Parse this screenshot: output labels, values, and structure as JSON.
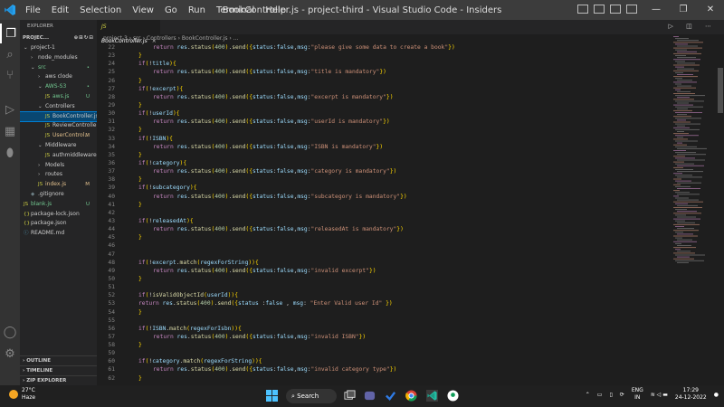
{
  "titlebar": {
    "menu": [
      "File",
      "Edit",
      "Selection",
      "View",
      "Go",
      "Run",
      "Terminal",
      "Help"
    ],
    "title": "BookController.js - project-third - Visual Studio Code - Insiders"
  },
  "sidebar": {
    "header": "EXPLORER",
    "project": "PROJEC...",
    "items": [
      {
        "label": "project-1",
        "indent": 0,
        "arrow": "⌄",
        "status": "",
        "type": "folder"
      },
      {
        "label": "node_modules",
        "indent": 1,
        "arrow": "›",
        "status": "",
        "type": "folder"
      },
      {
        "label": "src",
        "indent": 1,
        "arrow": "⌄",
        "status": "•",
        "type": "folder"
      },
      {
        "label": "aws clode",
        "indent": 2,
        "arrow": "›",
        "status": "",
        "type": "folder"
      },
      {
        "label": "AWS-S3",
        "indent": 2,
        "arrow": "⌄",
        "status": "•",
        "type": "folder"
      },
      {
        "label": "aws.js",
        "indent": 3,
        "arrow": "",
        "status": "U",
        "type": "js"
      },
      {
        "label": "Controllers",
        "indent": 2,
        "arrow": "⌄",
        "status": "",
        "type": "folder"
      },
      {
        "label": "BookController.js",
        "indent": 3,
        "arrow": "",
        "status": "",
        "type": "js",
        "selected": true
      },
      {
        "label": "ReviewController.js",
        "indent": 3,
        "arrow": "",
        "status": "",
        "type": "js"
      },
      {
        "label": "UserControl...",
        "indent": 3,
        "arrow": "",
        "status": "M",
        "type": "js"
      },
      {
        "label": "Middleware",
        "indent": 2,
        "arrow": "⌄",
        "status": "",
        "type": "folder"
      },
      {
        "label": "authmiddleware.js",
        "indent": 3,
        "arrow": "",
        "status": "",
        "type": "js"
      },
      {
        "label": "Models",
        "indent": 2,
        "arrow": "›",
        "status": "",
        "type": "folder"
      },
      {
        "label": "routes",
        "indent": 2,
        "arrow": "›",
        "status": "",
        "type": "folder"
      },
      {
        "label": "index.js",
        "indent": 2,
        "arrow": "",
        "status": "M",
        "type": "js"
      },
      {
        "label": ".gitignore",
        "indent": 1,
        "arrow": "",
        "status": "",
        "type": "git"
      },
      {
        "label": "blank.js",
        "indent": 0,
        "arrow": "",
        "status": "U",
        "type": "js"
      },
      {
        "label": "package-lock.json",
        "indent": 0,
        "arrow": "",
        "status": "",
        "type": "json"
      },
      {
        "label": "package.json",
        "indent": 0,
        "arrow": "",
        "status": "",
        "type": "json"
      },
      {
        "label": "README.md",
        "indent": 0,
        "arrow": "",
        "status": "",
        "type": "md"
      }
    ],
    "sections": [
      "OUTLINE",
      "TIMELINE",
      "ZIP EXPLORER"
    ]
  },
  "tabs": {
    "active": "BookController.js"
  },
  "breadcrumb": [
    "project-3",
    "src",
    "Controllers",
    "BookController.js",
    "..."
  ],
  "code": [
    {
      "n": "22",
      "i": 1,
      "t": "return res.status(400).send({status:false,msg:\"please give some data to create a book\"})"
    },
    {
      "n": "23",
      "i": 0,
      "t": "}"
    },
    {
      "n": "24",
      "i": 0,
      "t": "if(!title){"
    },
    {
      "n": "25",
      "i": 1,
      "t": "return res.status(400).send({status:false,msg:\"title is mandatory\"})"
    },
    {
      "n": "26",
      "i": 0,
      "t": "}"
    },
    {
      "n": "27",
      "i": 0,
      "t": "if(!excerpt){"
    },
    {
      "n": "28",
      "i": 1,
      "t": "return res.status(400).send({status:false,msg:\"excerpt is mandatory\"})"
    },
    {
      "n": "29",
      "i": 0,
      "t": "}"
    },
    {
      "n": "30",
      "i": 0,
      "t": "if(!userId){"
    },
    {
      "n": "31",
      "i": 1,
      "t": "return res.status(400).send({status:false,msg:\"userId is mandatory\"})"
    },
    {
      "n": "32",
      "i": 0,
      "t": "}"
    },
    {
      "n": "33",
      "i": 0,
      "t": "if(!ISBN){"
    },
    {
      "n": "34",
      "i": 1,
      "t": "return res.status(400).send({status:false,msg:\"ISBN is mandatory\"})"
    },
    {
      "n": "35",
      "i": 0,
      "t": "}"
    },
    {
      "n": "36",
      "i": 0,
      "t": "if(!category){"
    },
    {
      "n": "37",
      "i": 1,
      "t": "return res.status(400).send({status:false,msg:\"category is mandatory\"})"
    },
    {
      "n": "38",
      "i": 0,
      "t": "}"
    },
    {
      "n": "39",
      "i": 0,
      "t": "if(!subcategory){"
    },
    {
      "n": "40",
      "i": 1,
      "t": "return res.status(400).send({status:false,msg:\"subcategory is mandatory\"})"
    },
    {
      "n": "41",
      "i": 0,
      "t": "}"
    },
    {
      "n": "42",
      "i": 0,
      "t": ""
    },
    {
      "n": "43",
      "i": 0,
      "t": "if(!releasedAt){"
    },
    {
      "n": "44",
      "i": 1,
      "t": "return res.status(400).send({status:false,msg:\"releasedAt is mandatory\"})"
    },
    {
      "n": "45",
      "i": 0,
      "t": "}"
    },
    {
      "n": "46",
      "i": 0,
      "t": ""
    },
    {
      "n": "47",
      "i": 0,
      "t": ""
    },
    {
      "n": "48",
      "i": 0,
      "t": "if(!excerpt.match(regexForString)){"
    },
    {
      "n": "49",
      "i": 1,
      "t": "return res.status(400).send({status:false,msg:\"invalid excerpt\"})"
    },
    {
      "n": "50",
      "i": 0,
      "t": "}"
    },
    {
      "n": "51",
      "i": 0,
      "t": ""
    },
    {
      "n": "52",
      "i": 0,
      "t": "if(!isValidObjectId(userId)){"
    },
    {
      "n": "53",
      "i": 0,
      "t": "return res.status(400).send({status :false , msg: \"Enter Valid user Id\" })"
    },
    {
      "n": "54",
      "i": 0,
      "t": "}"
    },
    {
      "n": "55",
      "i": 0,
      "t": ""
    },
    {
      "n": "56",
      "i": 0,
      "t": "if(!ISBN.match(regexForIsbn)){"
    },
    {
      "n": "57",
      "i": 1,
      "t": "return res.status(400).send({status:false,msg:\"invalid ISBN\"})"
    },
    {
      "n": "58",
      "i": 0,
      "t": "}"
    },
    {
      "n": "59",
      "i": 0,
      "t": ""
    },
    {
      "n": "60",
      "i": 0,
      "t": "if(!category.match(regexForString)){"
    },
    {
      "n": "61",
      "i": 1,
      "t": "return res.status(400).send({status:false,msg:\"invalid category type\"})"
    },
    {
      "n": "62",
      "i": 0,
      "t": "}"
    }
  ],
  "taskbar": {
    "temp": "27°C",
    "weather": "Haze",
    "search": "Search",
    "lang1": "ENG",
    "lang2": "IN",
    "time": "17:29",
    "date": "24-12-2022"
  },
  "colors": {
    "accent": "#007acc",
    "selection": "#094771"
  }
}
